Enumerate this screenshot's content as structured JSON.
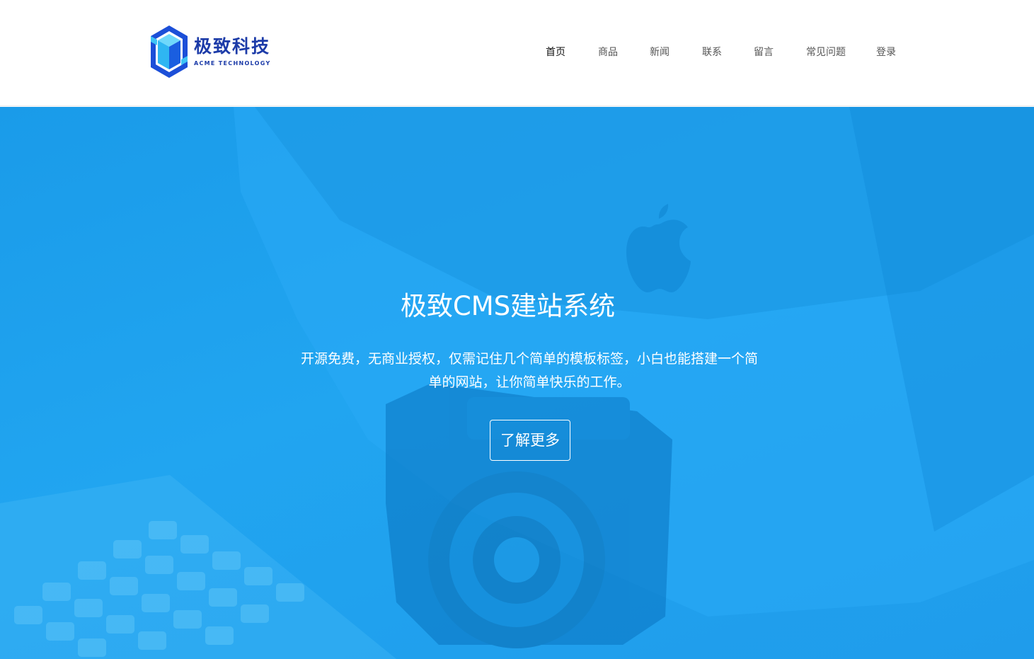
{
  "brand": {
    "name_cn": "极致科技",
    "name_en": "ACME TECHNOLOGY",
    "logo_icon": "hexagon-cube-logo"
  },
  "nav": {
    "items": [
      {
        "label": "首页",
        "active": true
      },
      {
        "label": "商品",
        "active": false
      },
      {
        "label": "新闻",
        "active": false
      },
      {
        "label": "联系",
        "active": false
      },
      {
        "label": "留言",
        "active": false
      },
      {
        "label": "常见问题",
        "active": false
      },
      {
        "label": "登录",
        "active": false
      }
    ]
  },
  "hero": {
    "title": "极致CMS建站系统",
    "description": "开源免费，无商业授权，仅需记住几个简单的模板标签，小白也能搭建一个简单的网站，让你简单快乐的工作。",
    "button_label": "了解更多",
    "background_icon": "apple-logo"
  },
  "colors": {
    "hero_blue": "#21a5f0",
    "brand_blue": "#1c3ba8",
    "logo_light": "#3fc3f5",
    "nav_text": "#555555",
    "nav_active": "#111111"
  }
}
